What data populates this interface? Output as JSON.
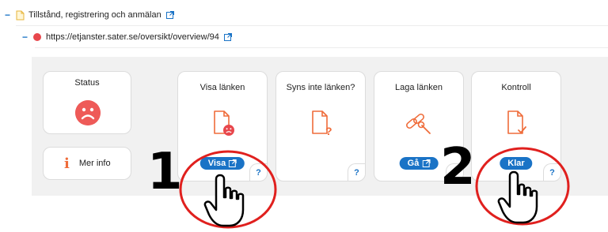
{
  "tree": {
    "row1": {
      "toggle": "−",
      "label": "Tillstånd, registrering och anmälan"
    },
    "row2": {
      "toggle": "−",
      "url": "https://etjanster.sater.se/oversikt/overview/94"
    }
  },
  "panel": {
    "status": {
      "label": "Status",
      "state_icon": "sad-face-icon"
    },
    "info": {
      "icon": "i",
      "label": "Mer info"
    },
    "tiles": [
      {
        "title": "Visa länken",
        "icon": "document-sad-icon",
        "button": "Visa",
        "help": "?"
      },
      {
        "title": "Syns inte länken?",
        "icon": "document-question-icon",
        "help": "?"
      },
      {
        "title": "Laga länken",
        "icon": "broken-link-wrench-icon",
        "button": "Gå",
        "help": "?"
      },
      {
        "title": "Kontroll",
        "icon": "document-check-icon",
        "button": "Klar",
        "help": "?"
      }
    ]
  },
  "annotations": {
    "step1": "1",
    "step2": "2"
  },
  "colors": {
    "accent": "#1a73c6",
    "icon_orange": "#ef6c3a",
    "error_red": "#e8474c",
    "annotation_red": "#e0201e"
  }
}
